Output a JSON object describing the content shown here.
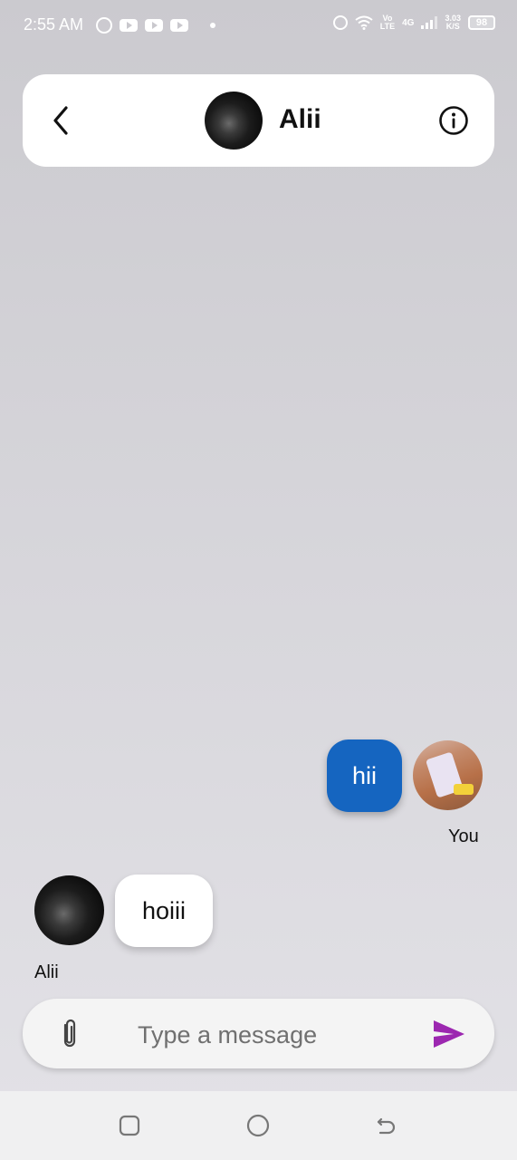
{
  "status_bar": {
    "time": "2:55 AM",
    "left_icons": [
      "whatsapp-icon",
      "youtube-icon",
      "youtube-icon",
      "youtube-icon",
      "notification-dot"
    ],
    "volte": "Vo\nLTE",
    "network": "4G",
    "speed": "3.03\nK/S",
    "battery": "98"
  },
  "header": {
    "contact_name": "Alii",
    "icons": [
      "back-arrow-icon",
      "info-icon"
    ]
  },
  "messages": [
    {
      "direction": "outgoing",
      "text": "hii",
      "sender_label": "You"
    },
    {
      "direction": "incoming",
      "text": "hoiii",
      "sender_label": "Alii"
    }
  ],
  "composer": {
    "placeholder": "Type a message",
    "value": "",
    "icons": [
      "paperclip-icon",
      "send-icon"
    ]
  },
  "nav_bar": {
    "icons": [
      "recents-square-icon",
      "home-circle-icon",
      "back-icon"
    ]
  },
  "colors": {
    "outgoing_bubble": "#1565c0",
    "incoming_bubble": "#ffffff",
    "send_icon": "#9c27b0",
    "background": "#d6d5da"
  }
}
